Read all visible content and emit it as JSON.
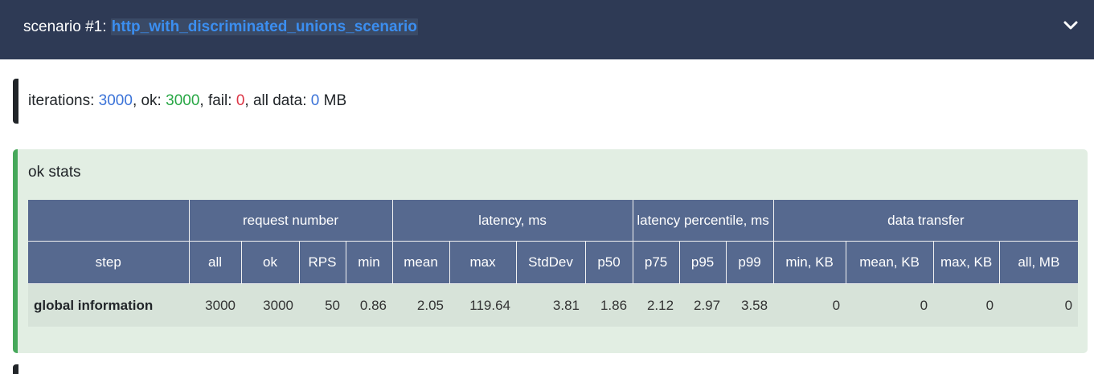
{
  "header": {
    "scenario_label": "scenario #1: ",
    "scenario_name": "http_with_discriminated_unions_scenario",
    "toggle_icon": "chevron-down-icon"
  },
  "summary": {
    "iterations_label": "iterations: ",
    "iterations": "3000",
    "ok_label": ", ok: ",
    "ok": "3000",
    "fail_label": ", fail: ",
    "fail": "0",
    "data_label": ", all data: ",
    "data": "0",
    "data_unit": " MB"
  },
  "ok_stats": {
    "title": "ok stats",
    "group_headers": [
      "request number",
      "latency, ms",
      "latency percentile, ms",
      "data transfer"
    ],
    "columns": [
      "step",
      "all",
      "ok",
      "RPS",
      "min",
      "mean",
      "max",
      "StdDev",
      "p50",
      "p75",
      "p95",
      "p99",
      "min, KB",
      "mean, KB",
      "max, KB",
      "all, MB"
    ],
    "rows": [
      [
        "global information",
        "3000",
        "3000",
        "50",
        "0.86",
        "2.05",
        "119.64",
        "3.81",
        "1.86",
        "2.12",
        "2.97",
        "3.58",
        "0",
        "0",
        "0",
        "0"
      ]
    ]
  },
  "colors": {
    "header_bg": "#2e3a55",
    "accent_blue": "#3b8ef0",
    "ok_green": "#28a745",
    "fail_red": "#dc3545",
    "ok_box_bg": "#e2eee3",
    "table_header_bg": "#56698f"
  }
}
